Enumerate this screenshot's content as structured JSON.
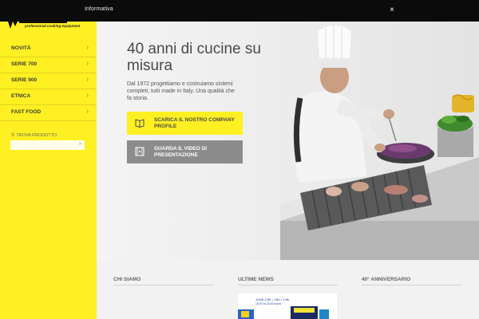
{
  "cookie_bar": {
    "text": "Informativa",
    "close": "×"
  },
  "sidebar": {
    "logo_tagline": "professional cooking equipment",
    "nav": [
      {
        "label": "NOVITÀ"
      },
      {
        "label": "SERIE 700"
      },
      {
        "label": "SERIE 900"
      },
      {
        "label": "ETNICA"
      },
      {
        "label": "FAST FOOD"
      }
    ],
    "chevron": "›",
    "search": {
      "label": "TROVA PRODOTTO",
      "button": "›"
    }
  },
  "hero": {
    "title": "40 anni di cucine su misura",
    "text": "Dal 1972 progettiamo e costruiamo sistemi completi, tutti made in Italy. Una qualità che fa storia.",
    "cta_profile": {
      "label": "SCARICA IL NOSTRO COMPANY PROFILE",
      "icon": "book-icon"
    },
    "cta_video": {
      "label": "GUARDA IL VIDEO DI PRESENTAZIONE",
      "icon": "film-icon"
    }
  },
  "sections": {
    "chi_siamo": "CHI SIAMO",
    "ultime_news": "ULTIME NEWS",
    "anniversario": "40° ANNIVERSARIO",
    "news_thumb": {
      "date_line": "JUNE 12th • 13th • 14th",
      "hours_line": "10:00 to 21:00 hours"
    }
  },
  "colors": {
    "brand_yellow": "#fff023",
    "dark_bar": "#0b0b0b",
    "cta_gray": "#8c8c8c"
  }
}
